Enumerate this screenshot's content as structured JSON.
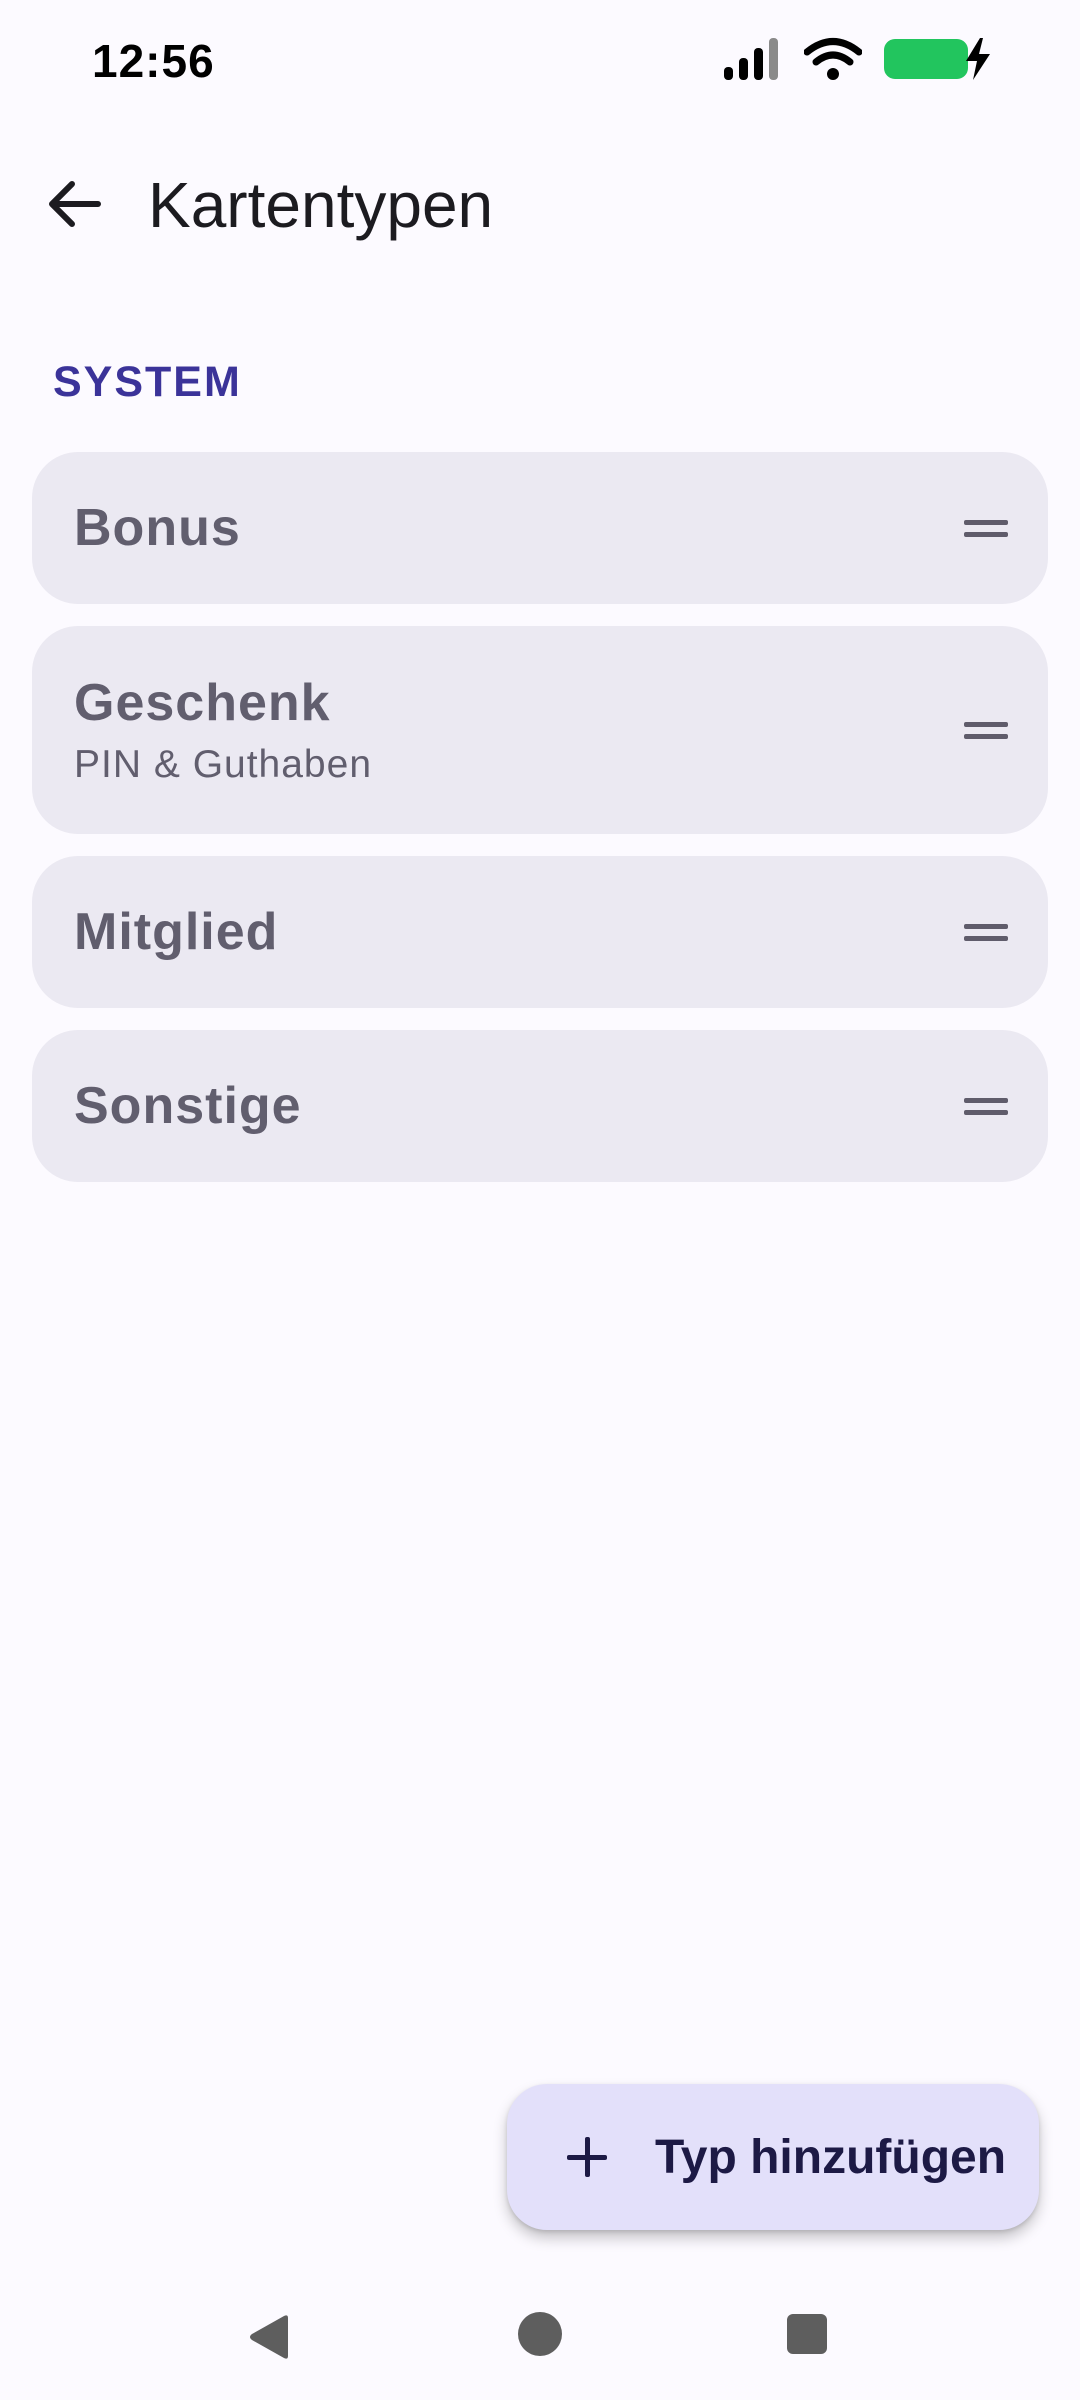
{
  "status_bar": {
    "time": "12:56",
    "icons": [
      "signal-icon",
      "wifi-icon",
      "battery-charging-icon"
    ],
    "battery_color": "#22C55E"
  },
  "app_bar": {
    "back_icon": "arrow-back-icon",
    "title": "Kartentypen"
  },
  "section": {
    "label": "SYSTEM",
    "color": "#3B3399"
  },
  "card_types": [
    {
      "title": "Bonus",
      "subtitle": ""
    },
    {
      "title": "Geschenk",
      "subtitle": "PIN & Guthaben"
    },
    {
      "title": "Mitglied",
      "subtitle": ""
    },
    {
      "title": "Sonstige",
      "subtitle": ""
    }
  ],
  "fab": {
    "icon": "plus-icon",
    "label": "Typ hinzufügen"
  },
  "nav_bar": {
    "icons": [
      "nav-back-icon",
      "nav-home-icon",
      "nav-recents-icon"
    ]
  }
}
